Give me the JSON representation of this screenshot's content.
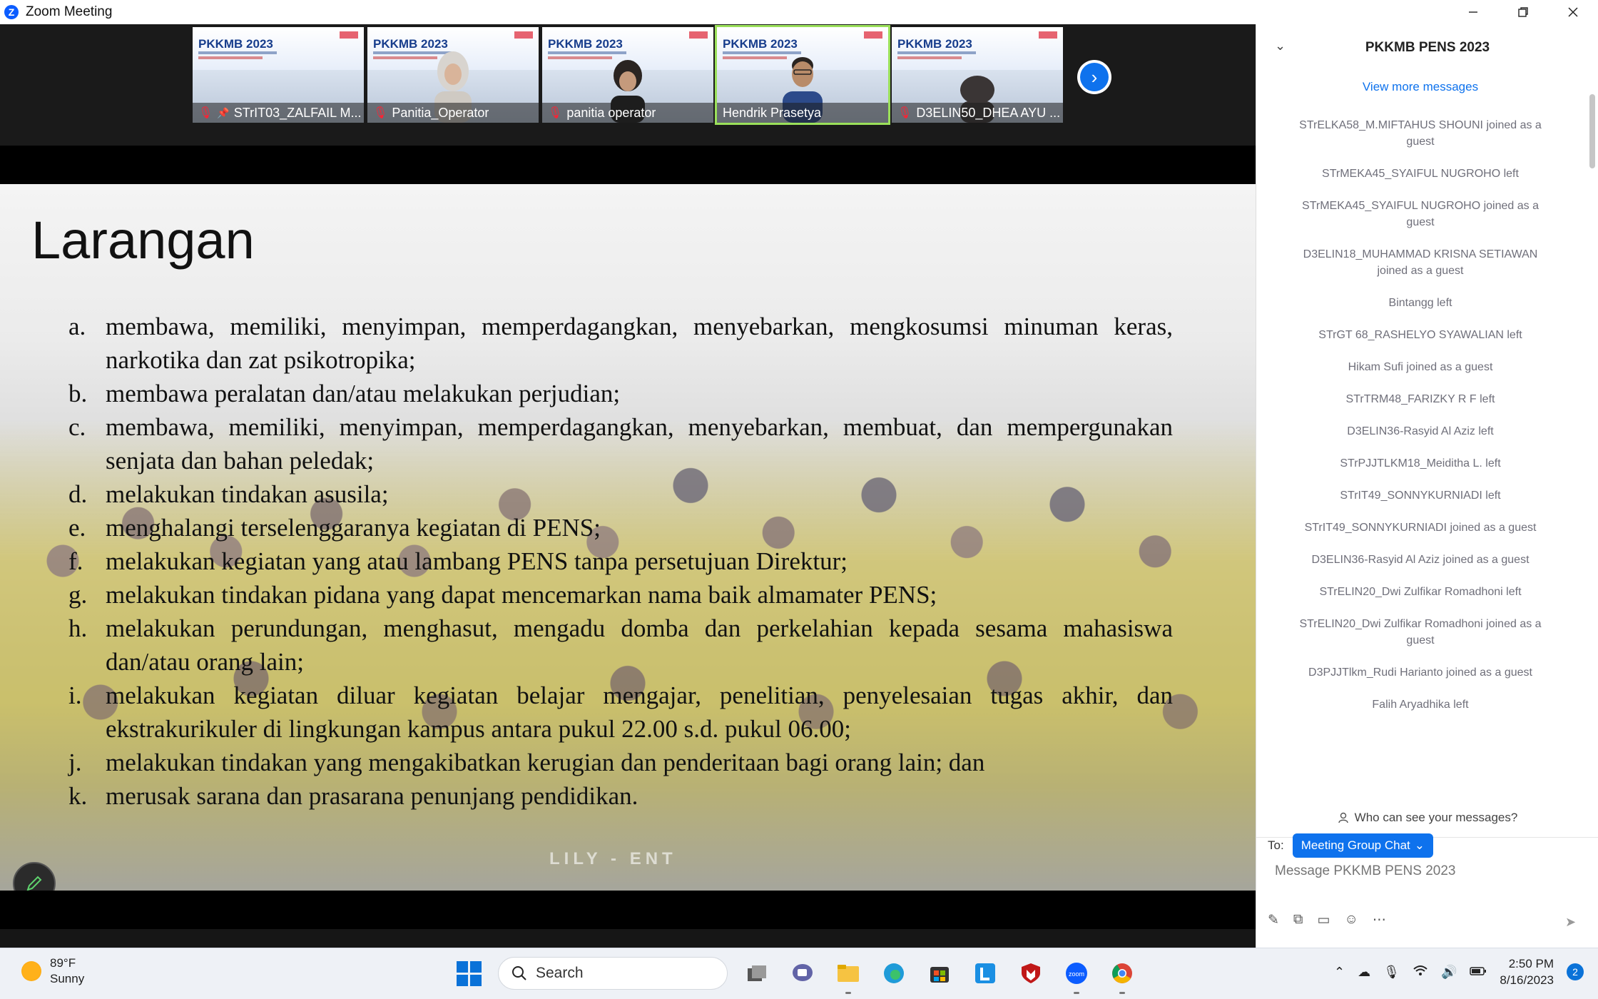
{
  "window": {
    "title": "Zoom Meeting",
    "app_icon": "Z"
  },
  "participants": [
    {
      "name": "STrIT03_ZALFAIL M...",
      "mic_muted": true,
      "pinned": true,
      "active": false
    },
    {
      "name": "Panitia_Operator",
      "mic_muted": true,
      "pinned": false,
      "active": false
    },
    {
      "name": "panitia operator",
      "mic_muted": true,
      "pinned": false,
      "active": false
    },
    {
      "name": "Hendrik Prasetya",
      "mic_muted": false,
      "pinned": false,
      "active": true
    },
    {
      "name": "D3ELIN50_DHEA AYU ...",
      "mic_muted": true,
      "pinned": false,
      "active": false
    }
  ],
  "thumb_brand": "PKKMB 2023",
  "slide": {
    "title": "Larangan",
    "items": [
      {
        "letter": "a.",
        "text": "membawa, memiliki, menyimpan, memperdagangkan, menyebarkan, mengkosumsi minuman keras, narkotika dan zat psikotropika;"
      },
      {
        "letter": "b.",
        "text": "membawa peralatan dan/atau melakukan perjudian;"
      },
      {
        "letter": "c.",
        "text": "membawa, memiliki, menyimpan, memperdagangkan, menyebarkan, membuat, dan mempergunakan senjata dan bahan peledak;"
      },
      {
        "letter": "d.",
        "text": "melakukan tindakan asusila;"
      },
      {
        "letter": "e.",
        "text": "menghalangi terselenggaranya kegiatan di PENS;"
      },
      {
        "letter": "f.",
        "text": "melakukan kegiatan yang atau lambang PENS tanpa persetujuan Direktur;"
      },
      {
        "letter": "g.",
        "text": "melakukan tindakan pidana yang dapat mencemarkan nama baik almamater PENS;"
      },
      {
        "letter": "h.",
        "text": "melakukan perundungan, menghasut, mengadu domba dan perkelahian kepada sesama mahasiswa dan/atau orang lain;"
      },
      {
        "letter": "i.",
        "text": "melakukan kegiatan diluar kegiatan belajar mengajar, penelitian, penyelesaian tugas akhir, dan ekstrakurikuler di lingkungan kampus antara pukul 22.00 s.d. pukul 06.00;"
      },
      {
        "letter": "j.",
        "text": "melakukan tindakan yang mengakibatkan kerugian dan penderitaan bagi orang lain; dan"
      },
      {
        "letter": "k.",
        "text": "merusak sarana dan prasarana penunjang pendidikan."
      }
    ],
    "watermark": "LILY - ENT"
  },
  "chat": {
    "title": "PKKMB PENS 2023",
    "view_more": "View more messages",
    "messages": [
      "STrELKA58_M.MIFTAHUS SHOUNI joined as a guest",
      "STrMEKA45_SYAIFUL NUGROHO left",
      "STrMEKA45_SYAIFUL NUGROHO joined as a guest",
      "D3ELIN18_MUHAMMAD KRISNA SETIAWAN joined as a guest",
      "Bintangg left",
      "STrGT 68_RASHELYO SYAWALIAN left",
      "Hikam Sufi joined as a guest",
      "STrTRM48_FARIZKY R F left",
      "D3ELIN36-Rasyid Al Aziz left",
      "STrPJJTLKM18_Meiditha L. left",
      "STrIT49_SONNYKURNIADI left",
      "STrIT49_SONNYKURNIADI joined as a guest",
      "D3ELIN36-Rasyid Al Aziz joined as a guest",
      "STrELIN20_Dwi Zulfikar Romadhoni left",
      "STrELIN20_Dwi Zulfikar Romadhoni joined as a guest",
      "D3PJJTlkm_Rudi Harianto joined as a guest",
      "Falih Aryadhika left"
    ],
    "who_can_see": "Who can see your messages?",
    "to_label": "To:",
    "recipient": "Meeting Group Chat",
    "input_placeholder": "Message PKKMB PENS 2023"
  },
  "taskbar": {
    "weather_temp": "89°F",
    "weather_desc": "Sunny",
    "search_label": "Search",
    "time": "2:50 PM",
    "date": "8/16/2023",
    "notification_count": "2"
  },
  "colors": {
    "accent": "#0e72ed",
    "active_speaker": "#9be05a",
    "muted": "#ff2233"
  }
}
